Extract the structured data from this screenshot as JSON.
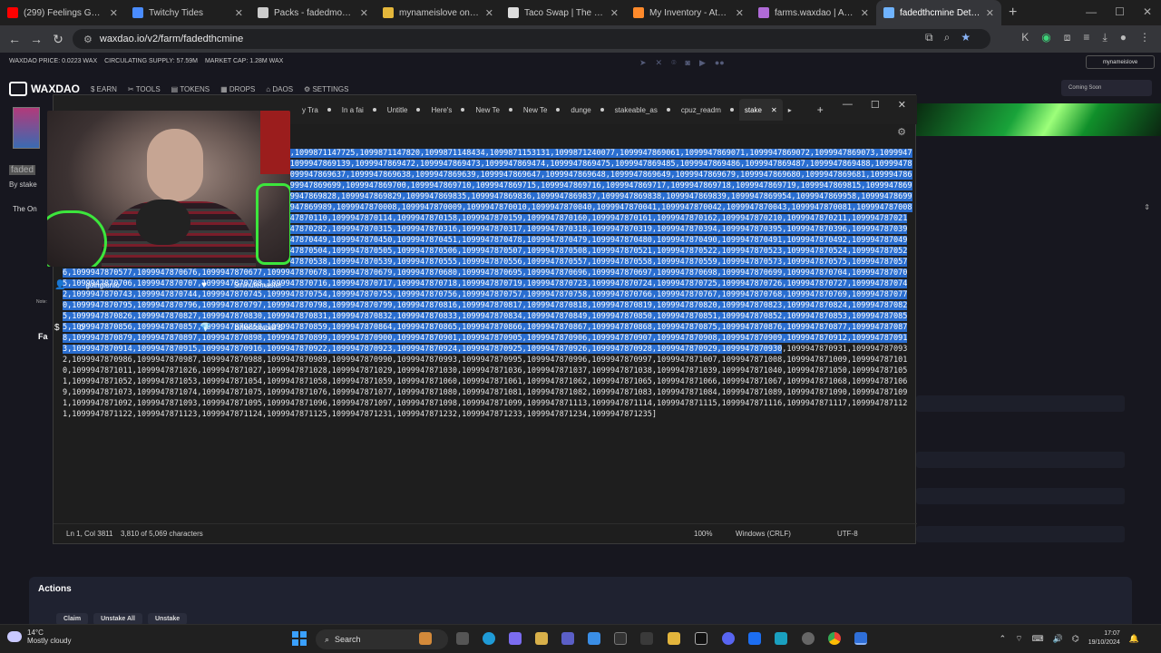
{
  "browser": {
    "tabs": [
      {
        "title": "(299) Feelings Good Mix - ",
        "color": "#ff0000"
      },
      {
        "title": "Twitchy Tides",
        "color": "#4a8cff"
      },
      {
        "title": "Packs - fadedmonsuta on",
        "color": "#cccccc"
      },
      {
        "title": "mynameislove on NFTHive",
        "color": "#e4b73b"
      },
      {
        "title": "Taco Swap | The commun",
        "color": "#dddddd"
      },
      {
        "title": "My Inventory - AtomicHub",
        "color": "#ff8a2b"
      },
      {
        "title": "farms.waxdao | Account",
        "color": "#b06bd8"
      },
      {
        "title": "fadedthcmine Details",
        "color": "#6fb3ff"
      }
    ],
    "url": "waxdao.io/v2/farm/fadedthcmine"
  },
  "waxdao": {
    "stats": [
      "WAXDAO PRICE: 0.0223 WAX",
      "CIRCULATING SUPPLY: 57.59M",
      "MARKET CAP: 1.28M WAX"
    ],
    "wallet": "mynameislove",
    "logo": "WAXDAO",
    "nav": [
      "EARN",
      "TOOLS",
      "TOKENS",
      "DROPS",
      "DAOS",
      "SETTINGS"
    ],
    "coming_soon": "Coming Soon",
    "farm_name": "faded",
    "by": "By stake",
    "the_on": "The On",
    "note": "Note:",
    "fa": "Fa",
    "actions_title": "Actions",
    "action_buttons": [
      "Claim",
      "Unstake All",
      "Unstake"
    ]
  },
  "notepad": {
    "tabs": [
      "y Tra",
      "In a fai",
      "Untitle",
      "Here's",
      "New Te",
      "New Te",
      "dunge",
      "stakeable_as",
      "cpuz_readm",
      "stake"
    ],
    "selected_text": "1138379,1099871138562,1099871139681,1099871140719,1099871147725,1099871147820,1099871148434,1099871153131,1099871240077,1099947869061,1099947869071,1099947869072,1099947869073,1099947869074,1099947869075,1099947869137,1099947869138,1099947869139,1099947869472,1099947869473,1099947869474,1099947869475,1099947869485,1099947869486,1099947869487,1099947869488,1099947869489,1099947869497,1099947869635,1099947869636,1099947869637,1099947869638,1099947869639,1099947869647,1099947869648,1099947869649,1099947869679,1099947869680,1099947869681,1099947869682,1099947869696,1099947869697,1099947869698,1099947869699,1099947869700,1099947869710,1099947869715,1099947869716,1099947869717,1099947869718,1099947869719,1099947869815,1099947869816,1099947869817,1099947869826,1099947869827,1099947869828,1099947869829,1099947869835,1099947869836,1099947869837,1099947869838,1099947869839,1099947869954,1099947869958,1099947869985,1099947869986,1099947869987,1099947869988,1099947869989,1099947870008,1099947870009,1099947870010,1099947870040,1099947870041,1099947870042,1099947870043,1099947870081,1099947870082,1099947870083,1099947870084,1099947870085,1099947870110,1099947870114,1099947870158,1099947870159,1099947870160,1099947870161,1099947870162,1099947870210,1099947870211,1099947870212,1099947870279,1099947870280,1099947870281,1099947870282,1099947870315,1099947870316,1099947870317,1099947870318,1099947870319,1099947870394,1099947870395,1099947870396,1099947870397,1099947870398,1099947870447,1099947870448,1099947870449,1099947870450,1099947870451,1099947870478,1099947870479,1099947870480,1099947870490,1099947870491,1099947870492,1099947870493,1099947870494,1099947870495,1099947870496,1099947870504,1099947870505,1099947870506,1099947870507,1099947870508,1099947870521,1099947870522,1099947870523,1099947870524,1099947870525,1099947870535,1099947870536,1099947870537,1099947870538,1099947870539,1099947870555,1099947870556,1099947870557,1099947870558,1099947870559,1099947870573,1099947870575,1099947870576,1099947870577,1099947870676,1099947870677,1099947870678,1099947870679,1099947870680,1099947870695,1099947870696,1099947870697,1099947870698,1099947870699,1099947870704,1099947870705,1099947870706,1099947870707,1099947870708,1099947870716,1099947870717,1099947870718,1099947870719,1099947870723,1099947870724,1099947870725,1099947870726,1099947870727,1099947870742,1099947870743,1099947870744,1099947870745,1099947870754,1099947870755,1099947870756,1099947870757,1099947870758,1099947870766,1099947870767,1099947870768,1099947870769,1099947870770,1099947870795,1099947870796,1099947870797,1099947870798,1099947870799,1099947870816,1099947870817,1099947870818,1099947870819,1099947870820,1099947870823,1099947870824,1099947870825,1099947870826,1099947870827,1099947870830,1099947870831,1099947870832,1099947870833,1099947870834,1099947870849,1099947870850,1099947870851,1099947870852,1099947870853,1099947870855,1099947870856,1099947870857,1099947870858,1099947870859,1099947870864,1099947870865,1099947870866,1099947870867,1099947870868,1099947870875,1099947870876,1099947870877,1099947870878,1099947870879,1099947870897,1099947870898,1099947870899,1099947870900,1099947870901,1099947870905,1099947870906,1099947870907,1099947870908,1099947870909,1099947870912,1099947870913,1099947870914,1099947870915,1099947870916,1099947870922,1099947870923,1099947870924,1099947870925,1099947870926,1099947870928,1099947870929,1099947870930",
    "unselected_text": ",1099947870931,1099947870932,1099947870986,1099947870987,1099947870988,1099947870989,1099947870990,1099947870993,1099947870995,1099947870996,1099947870997,1099947871007,1099947871008,1099947871009,1099947871010,1099947871011,1099947871026,1099947871027,1099947871028,1099947871029,1099947871030,1099947871036,1099947871037,1099947871038,1099947871039,1099947871040,1099947871050,1099947871051,1099947871052,1099947871053,1099947871054,1099947871058,1099947871059,1099947871060,1099947871061,1099947871062,1099947871065,1099947871066,1099947871067,1099947871068,1099947871069,1099947871073,1099947871074,1099947871075,1099947871076,1099947871077,1099947871080,1099947871081,1099947871082,1099947871083,1099947871084,1099947871089,1099947871090,1099947871091,1099947871092,1099947871093,1099947871095,1099947871096,1099947871097,1099947871098,1099947871099,1099947871113,1099947871114,1099947871115,1099947871116,1099947871117,1099947871121,1099947871122,1099947871123,1099947871124,1099947871125,1099947871231,1099947871232,1099947871233,1099947871234,1099947871235]",
    "status": {
      "position": "Ln 1, Col 3811",
      "chars": "3,810 of 5,069 characters",
      "zoom": "100%",
      "eol": "Windows (CRLF)",
      "encoding": "UTF-8"
    }
  },
  "overlay": {
    "donors": [
      {
        "name": "goingtonto",
        "icon": "👤"
      },
      {
        "name": "5minutemaster",
        "icon": "♥"
      },
      {
        "name": "0",
        "icon": "$"
      },
      {
        "name": "billionfootball 5",
        "icon": "💎"
      }
    ]
  },
  "taskbar": {
    "temp": "14°C",
    "weather": "Mostly cloudy",
    "search": "Search",
    "time": "17:07",
    "date": "19/10/2024"
  }
}
